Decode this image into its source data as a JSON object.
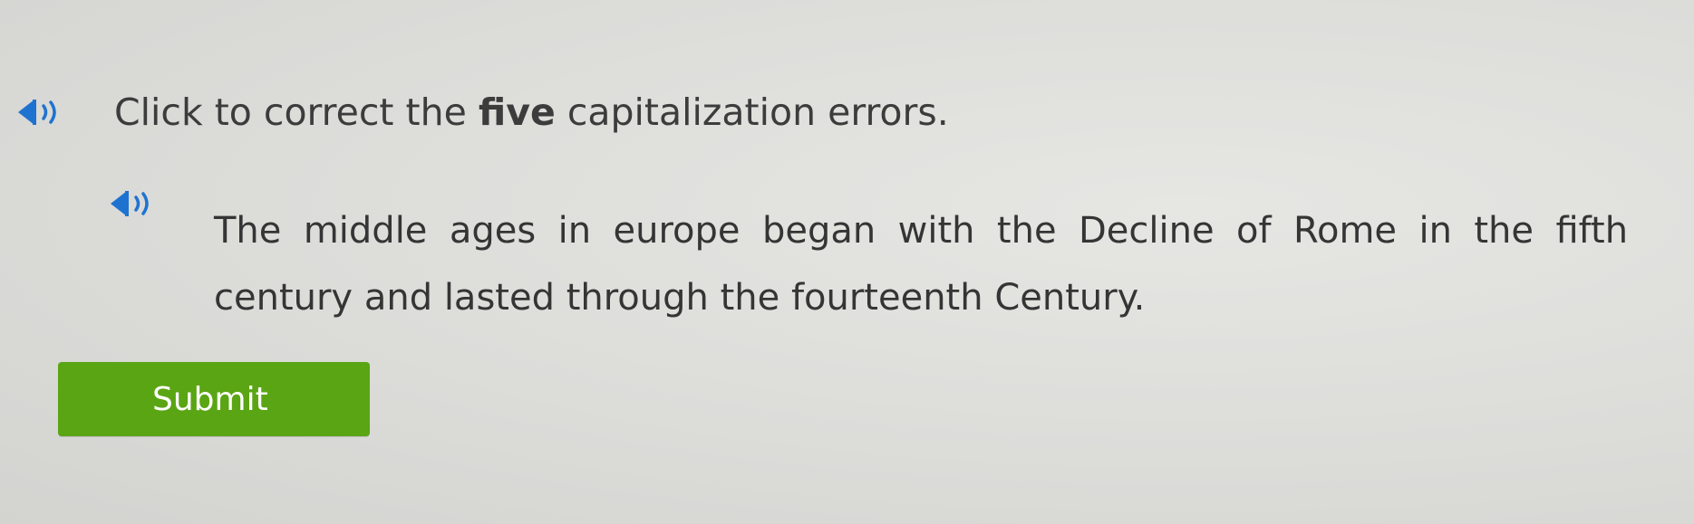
{
  "instruction": {
    "before": "Click to correct the ",
    "emphasis": "five",
    "after": " capitalization errors."
  },
  "passage": {
    "line1": [
      "The",
      "middle",
      "ages",
      "in",
      "europe",
      "began",
      "with",
      "the",
      "Decline",
      "of",
      "Rome",
      "in",
      "the",
      "fifth"
    ],
    "line2": [
      "century",
      "and",
      "lasted",
      "through",
      "the",
      "fourteenth",
      "Century."
    ]
  },
  "submit": {
    "label": "Submit"
  },
  "colors": {
    "accent": "#5aa514",
    "speaker_icon": "#1e73d1"
  },
  "icons": {
    "instruction_audio": "speaker-icon",
    "passage_audio": "speaker-icon"
  }
}
